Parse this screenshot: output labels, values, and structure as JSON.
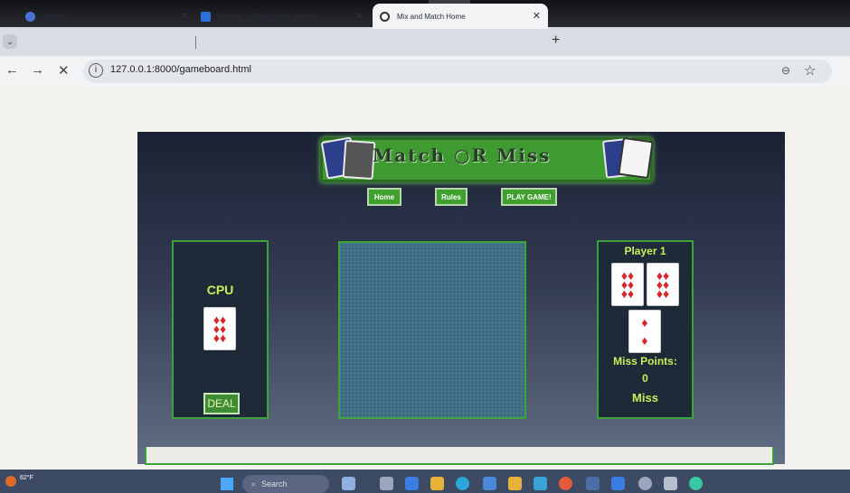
{
  "browser": {
    "tabs": [
      {
        "label": "History"
      },
      {
        "label": "Settings – Privacy and security"
      },
      {
        "label": "Mix and Match Home"
      }
    ],
    "url": "127.0.0.1:8000/gameboard.html"
  },
  "game": {
    "title": "Match ○R Miss",
    "nav": {
      "home": "Home",
      "rules": "Rules",
      "play": "PLAY GAME!"
    },
    "cpu": {
      "label": "CPU",
      "deal_button": "DEAL"
    },
    "player": {
      "label": "Player 1",
      "miss_points_label": "Miss Points:",
      "miss_points_value": "0",
      "status": "Miss"
    }
  },
  "taskbar": {
    "weather": "62°F",
    "search_placeholder": "Search"
  },
  "colors": {
    "accent_green": "#3ca33a",
    "label_lime": "#c8ef5a",
    "suit_red": "#d8262b"
  }
}
